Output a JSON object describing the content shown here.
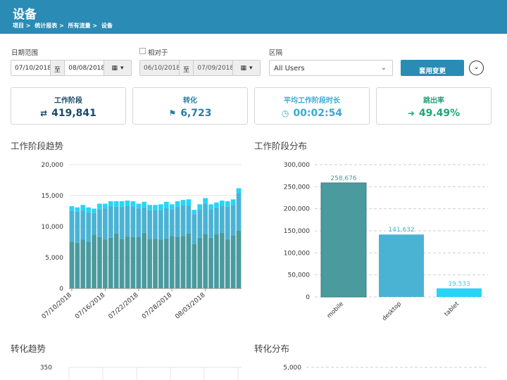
{
  "header": {
    "title": "设备",
    "breadcrumb": [
      "项目 >",
      "统计报表 >",
      "所有流量 >",
      "设备"
    ]
  },
  "filters": {
    "date_range_label": "日期范围",
    "start": "07/10/2018",
    "to": "至",
    "end": "08/08/2018",
    "compare_label": "相对于",
    "compare_start": "06/10/2018",
    "compare_end": "07/09/2018",
    "segment_label": "区隔",
    "segment_value": "All Users",
    "apply_label": "套用变更"
  },
  "kpis": [
    {
      "label": "工作阶段",
      "value": "419,841",
      "icon": "exchange-icon",
      "color": "#1a4a6b"
    },
    {
      "label": "转化",
      "value": "6,723",
      "icon": "flag-icon",
      "color": "#2a7fa8"
    },
    {
      "label": "平均工作阶段时长",
      "value": "00:02:54",
      "icon": "clock-icon",
      "color": "#3aaad4"
    },
    {
      "label": "跳出率",
      "value": "49.49%",
      "icon": "sign-out-icon",
      "color": "#1fa57a"
    }
  ],
  "sections": {
    "sessions_trend": "工作阶段趋势",
    "sessions_dist": "工作阶段分布",
    "conv_trend": "转化趋势",
    "conv_dist": "转化分布"
  },
  "colors": {
    "mobile": "#4a9a9e",
    "desktop": "#4ab3d4",
    "tablet": "#29d4f5",
    "brand": "#2a8bb5"
  },
  "chart_data": [
    {
      "type": "bar",
      "stacked": true,
      "ylim": [
        0,
        20000
      ],
      "yticks": [
        "0",
        "5,000",
        "10,000",
        "15,000",
        "20,000"
      ],
      "xticks": [
        "07/10/2018",
        "07/16/2018",
        "07/22/2018",
        "07/28/2018",
        "08/03/2018"
      ],
      "series": [
        {
          "name": "mobile",
          "values": [
            7500,
            7400,
            7900,
            7500,
            8700,
            8300,
            7900,
            8200,
            8900,
            8000,
            8400,
            8300,
            8300,
            9000,
            8000,
            8000,
            7900,
            8100,
            8500,
            8300,
            8500,
            8900,
            7200,
            8200,
            8800,
            8200,
            8800,
            9000,
            7900,
            8600,
            9400
          ]
        },
        {
          "name": "desktop",
          "values": [
            5000,
            5000,
            4700,
            4800,
            3500,
            4500,
            5000,
            5100,
            4300,
            5200,
            4900,
            4900,
            4600,
            4100,
            4700,
            4700,
            4800,
            4900,
            4300,
            4900,
            5000,
            4500,
            4800,
            4600,
            4900,
            4600,
            4300,
            4400,
            5300,
            4900,
            6000
          ]
        },
        {
          "name": "tablet",
          "values": [
            800,
            700,
            900,
            800,
            700,
            900,
            800,
            800,
            900,
            900,
            900,
            900,
            800,
            900,
            800,
            800,
            900,
            1000,
            800,
            900,
            800,
            1000,
            700,
            800,
            900,
            800,
            800,
            800,
            900,
            900,
            800
          ]
        }
      ]
    },
    {
      "type": "bar",
      "ylim": [
        0,
        300000
      ],
      "yticks": [
        "0",
        "50,000",
        "100,000",
        "150,000",
        "200,000",
        "250,000",
        "300,000"
      ],
      "categories": [
        "mobile",
        "desktop",
        "tablet"
      ],
      "values": [
        258676,
        141632,
        19533
      ],
      "value_labels": [
        "258,676",
        "141,632",
        "19,533"
      ]
    },
    {
      "type": "bar",
      "yticks": [
        "350"
      ]
    },
    {
      "type": "bar",
      "yticks": [
        "5,000"
      ]
    }
  ]
}
